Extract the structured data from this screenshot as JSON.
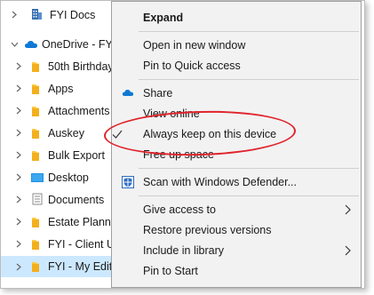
{
  "tree": {
    "items": [
      {
        "label": "FYI Docs",
        "icon": "building-icon"
      },
      {
        "label": "OneDrive - FY",
        "icon": "onedrive-cloud-icon"
      },
      {
        "label": "50th Birthday",
        "icon": "folder-icon"
      },
      {
        "label": "Apps",
        "icon": "folder-icon"
      },
      {
        "label": "Attachments",
        "icon": "folder-icon"
      },
      {
        "label": "Auskey",
        "icon": "folder-icon"
      },
      {
        "label": "Bulk Export",
        "icon": "folder-icon"
      },
      {
        "label": "Desktop",
        "icon": "desktop-folder-icon"
      },
      {
        "label": "Documents",
        "icon": "documents-folder-icon"
      },
      {
        "label": "Estate Plannin",
        "icon": "folder-icon"
      },
      {
        "label": "FYI - Client U",
        "icon": "folder-icon"
      },
      {
        "label": "FYI - My Edit",
        "icon": "folder-icon"
      }
    ]
  },
  "menu": {
    "expand": "Expand",
    "open_new_window": "Open in new window",
    "pin_quick_access": "Pin to Quick access",
    "share": "Share",
    "view_online": "View online",
    "always_keep": "Always keep on this device",
    "free_up_space": "Free up space",
    "scan_defender": "Scan with Windows Defender...",
    "give_access": "Give access to",
    "restore_versions": "Restore previous versions",
    "include_library": "Include in library",
    "pin_start": "Pin to Start"
  },
  "colors": {
    "highlight_oval": "#e0242c",
    "selection": "#cce8ff",
    "folder": "#ffc83d",
    "onedrive": "#0f78d4"
  }
}
